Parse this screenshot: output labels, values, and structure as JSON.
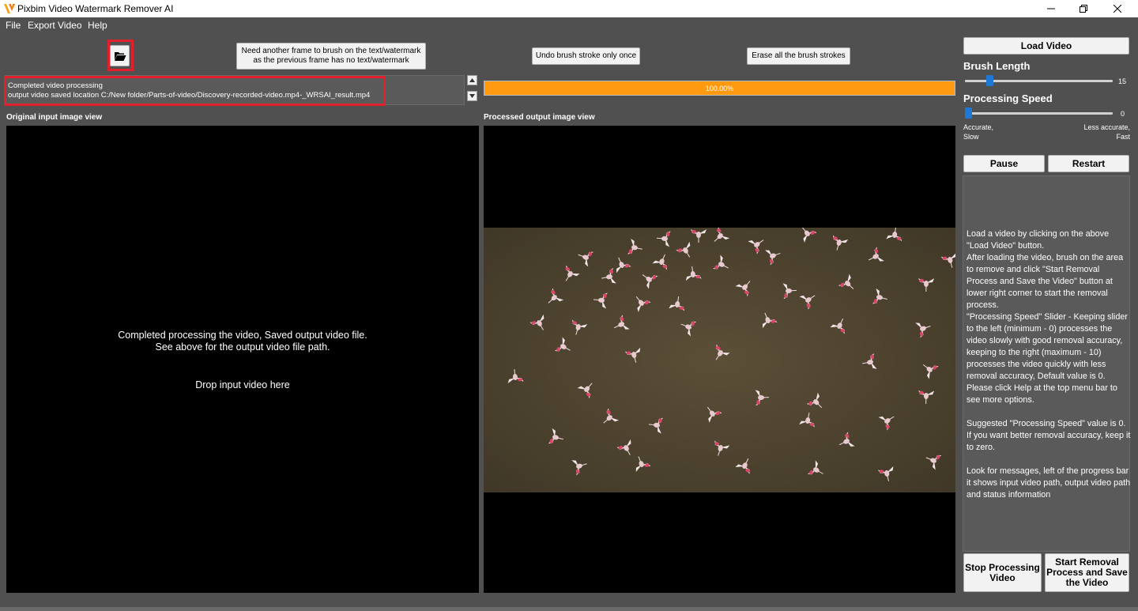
{
  "window": {
    "title": "Pixbim Video Watermark Remover AI"
  },
  "menu": {
    "items": [
      "File",
      "Export Video",
      "Help"
    ]
  },
  "toolbar": {
    "open_icon": "folder-open-icon",
    "another_frame_label": "Need another frame to brush on the text/watermark\nas the previous frame has no text/watermark",
    "undo_label": "Undo brush stroke only once",
    "erase_label": "Erase all the brush strokes"
  },
  "status": {
    "line1": "Completed video processing",
    "line2": "output video saved location C:/New folder/Parts-of-video/Discovery-recorded-video.mp4-_WRSAI_result.mp4"
  },
  "progress": {
    "value": 1.0,
    "label": "100.00%",
    "color": "#ff9a10"
  },
  "views": {
    "input_label": "Original input image view",
    "output_label": "Processed output image view",
    "input_message": "Completed processing the video, Saved output video file.\nSee above for the output video file path.",
    "drop_text": "Drop input video here"
  },
  "sidebar": {
    "load_video": "Load Video",
    "brush_length": {
      "title": "Brush Length",
      "value": 15,
      "min": 0,
      "max": 100
    },
    "processing_speed": {
      "title": "Processing Speed",
      "value": 0,
      "min": 0,
      "max": 10
    },
    "speed_left_label": "Accurate,\nSlow",
    "speed_right_label": "Less accurate,\nFast",
    "pause": "Pause",
    "restart": "Restart",
    "help_text": "Load a video by clicking on the above \"Load Video\" button.\nAfter loading the video, brush on the area to remove and click \"Start Removal Process and Save the Video\" button at lower right corner to start the removal process.\n\"Processing Speed\" Slider - Keeping slider to the left (minimum - 0) processes the video slowly with good removal accuracy, keeping to the right (maximum - 10) processes the video quickly with less removal accuracy, Default value is 0.\nPlease click Help at the top menu bar to see more options.\n\nSuggested \"Processing Speed\" value is 0. If you want better removal accuracy, keep it to zero.\n\nLook for messages, left of the progress bar it shows input video path, output video path and status information",
    "stop": "Stop Processing\nVideo",
    "start": "Start Removal\nProcess and Save\nthe Video"
  }
}
